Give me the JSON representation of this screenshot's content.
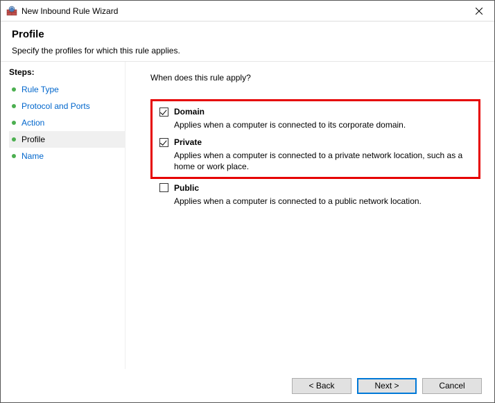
{
  "window": {
    "title": "New Inbound Rule Wizard"
  },
  "header": {
    "title": "Profile",
    "subtitle": "Specify the profiles for which this rule applies."
  },
  "sidebar": {
    "label": "Steps:",
    "items": [
      {
        "label": "Rule Type",
        "current": false
      },
      {
        "label": "Protocol and Ports",
        "current": false
      },
      {
        "label": "Action",
        "current": false
      },
      {
        "label": "Profile",
        "current": true
      },
      {
        "label": "Name",
        "current": false
      }
    ]
  },
  "main": {
    "question": "When does this rule apply?",
    "options": [
      {
        "label": "Domain",
        "desc": "Applies when a computer is connected to its corporate domain.",
        "checked": true,
        "highlighted": true
      },
      {
        "label": "Private",
        "desc": "Applies when a computer is connected to a private network location, such as a home or work place.",
        "checked": true,
        "highlighted": true
      },
      {
        "label": "Public",
        "desc": "Applies when a computer is connected to a public network location.",
        "checked": false,
        "highlighted": false
      }
    ]
  },
  "footer": {
    "back": "< Back",
    "next": "Next >",
    "cancel": "Cancel"
  }
}
